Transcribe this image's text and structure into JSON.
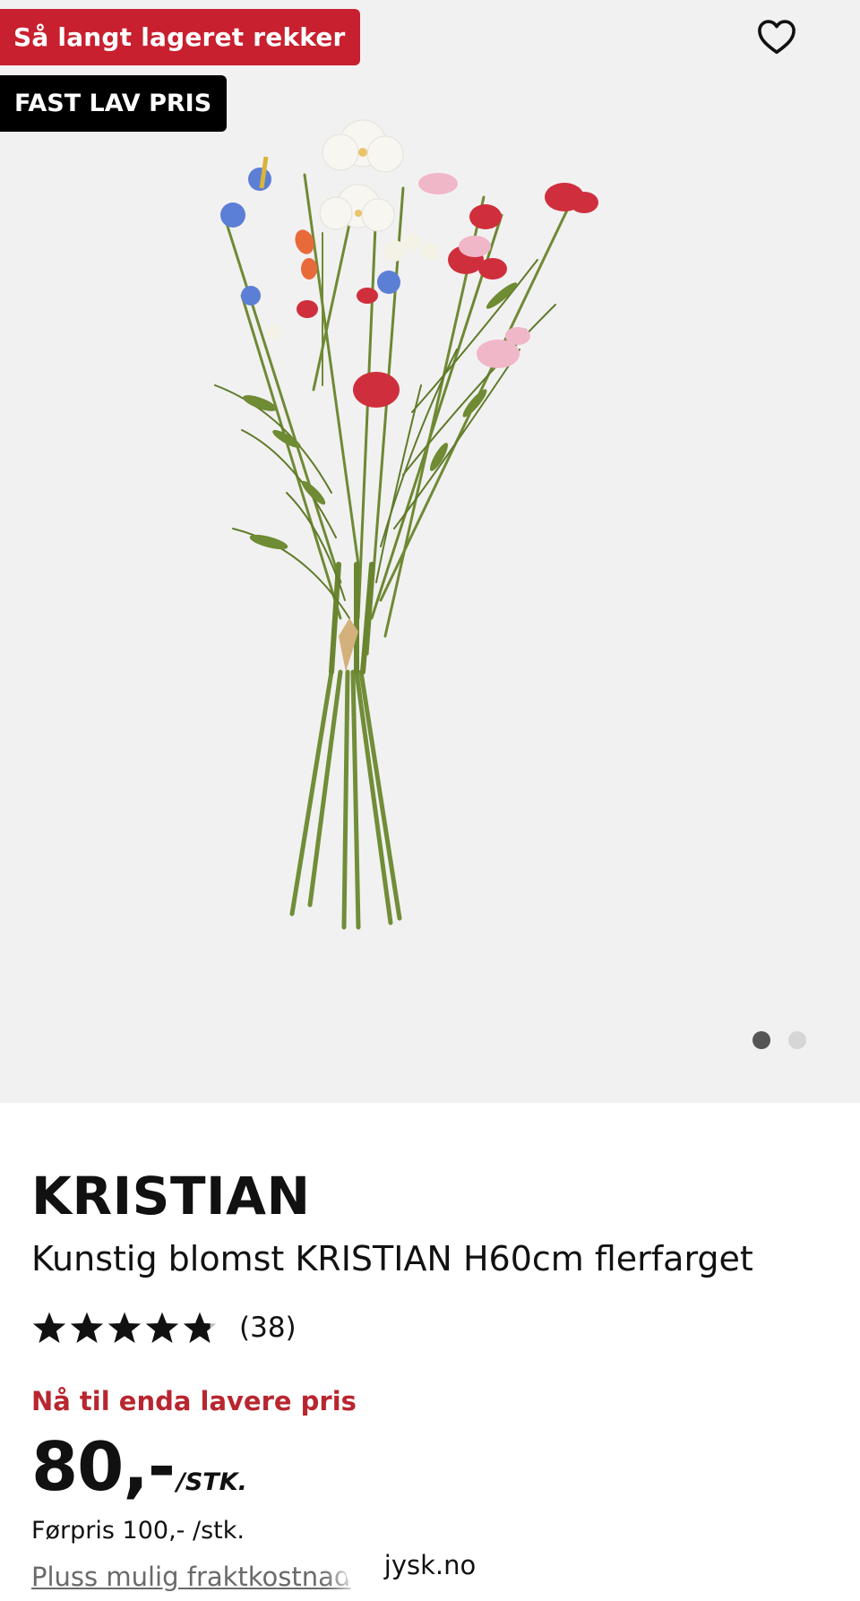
{
  "badges": {
    "stock": "Så langt lageret rekker",
    "price": "FAST LAV PRIS"
  },
  "icons": {
    "favorite": "heart-outline-icon",
    "star": "star-icon"
  },
  "gallery": {
    "image_alt": "Kunstig blomst KRISTIAN H60cm flerfarget",
    "slide_count": 2,
    "active_slide": 1
  },
  "product": {
    "brand": "KRISTIAN",
    "description": "Kunstig blomst KRISTIAN H60cm flerfarget",
    "rating": {
      "stars": 4.8,
      "max": 5,
      "count_label": "(38)"
    },
    "promo": "Nå til enda lavere pris",
    "price": "80,-",
    "unit": "/STK.",
    "before_price": "Førpris 100,- /stk.",
    "shipping": "Pluss mulig fraktkostnad"
  },
  "browser": {
    "url": "jysk.no"
  },
  "colors": {
    "stock_badge": "#c8202f",
    "price_badge": "#000000",
    "promo_text": "#b8262f",
    "gallery_bg": "#f2f1f1"
  }
}
